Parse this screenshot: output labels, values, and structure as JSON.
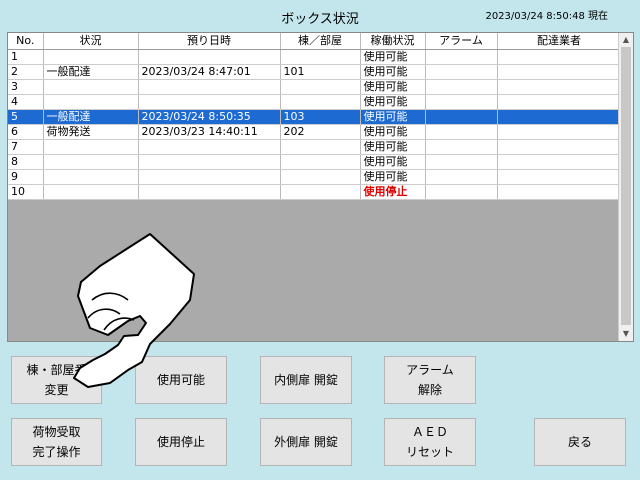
{
  "header": {
    "title": "ボックス状況",
    "datetime": "2023/03/24 8:50:48 現在"
  },
  "table": {
    "columns": [
      "No.",
      "状況",
      "預り日時",
      "棟／部屋",
      "稼働状況",
      "アラーム",
      "配達業者"
    ],
    "rows": [
      {
        "no": "1",
        "status": "",
        "datetime": "",
        "room": "",
        "operation": "使用可能",
        "alarm": "",
        "carrier": ""
      },
      {
        "no": "2",
        "status": "一般配達",
        "datetime": "2023/03/24 8:47:01",
        "room": "101",
        "operation": "使用可能",
        "alarm": "",
        "carrier": ""
      },
      {
        "no": "3",
        "status": "",
        "datetime": "",
        "room": "",
        "operation": "使用可能",
        "alarm": "",
        "carrier": ""
      },
      {
        "no": "4",
        "status": "",
        "datetime": "",
        "room": "",
        "operation": "使用可能",
        "alarm": "",
        "carrier": ""
      },
      {
        "no": "5",
        "status": "一般配達",
        "datetime": "2023/03/24 8:50:35",
        "room": "103",
        "operation": "使用可能",
        "alarm": "",
        "carrier": ""
      },
      {
        "no": "6",
        "status": "荷物発送",
        "datetime": "2023/03/23 14:40:11",
        "room": "202",
        "operation": "使用可能",
        "alarm": "",
        "carrier": ""
      },
      {
        "no": "7",
        "status": "",
        "datetime": "",
        "room": "",
        "operation": "使用可能",
        "alarm": "",
        "carrier": ""
      },
      {
        "no": "8",
        "status": "",
        "datetime": "",
        "room": "",
        "operation": "使用可能",
        "alarm": "",
        "carrier": ""
      },
      {
        "no": "9",
        "status": "",
        "datetime": "",
        "room": "",
        "operation": "使用可能",
        "alarm": "",
        "carrier": ""
      },
      {
        "no": "10",
        "status": "",
        "datetime": "",
        "room": "",
        "operation": "使用停止",
        "alarm": "",
        "carrier": ""
      }
    ]
  },
  "buttons": {
    "change_room_line1": "棟・部屋番",
    "change_room_line2": "変更",
    "enable": "使用可能",
    "inner_door": "内側扉 開錠",
    "alarm_reset_line1": "アラーム",
    "alarm_reset_line2": "解除",
    "parcel_line1": "荷物受取",
    "parcel_line2": "完了操作",
    "disable": "使用停止",
    "outer_door": "外側扉 開錠",
    "aed_line1": "ＡＥＤ",
    "aed_line2": "リセット",
    "back": "戻る"
  },
  "scroll": {
    "up_icon": "▲",
    "down_icon": "▼"
  },
  "colors": {
    "background": "#c3e6ec",
    "highlight": "#1d6ad3",
    "stop_text": "#e00000"
  }
}
